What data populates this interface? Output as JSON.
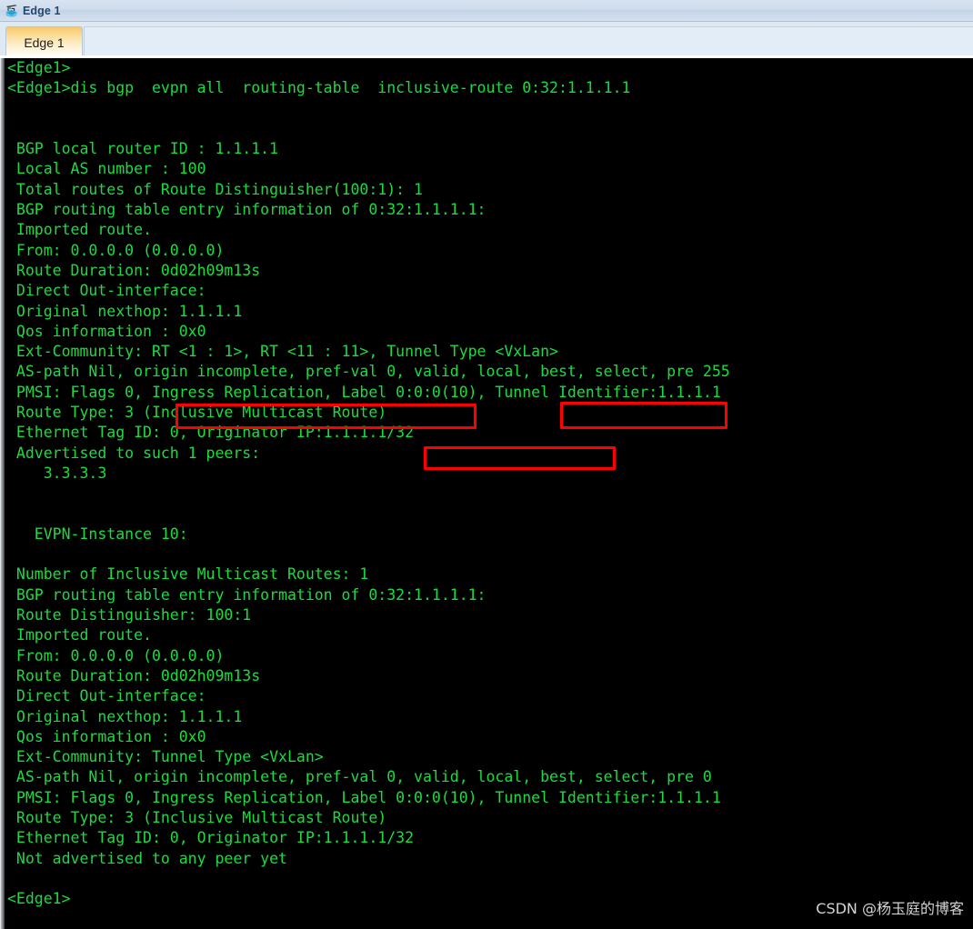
{
  "window": {
    "title": "Edge 1",
    "icon": "router-device-icon"
  },
  "tabs": [
    {
      "label": "Edge 1",
      "active": true
    }
  ],
  "watermark": "CSDN @杨玉庭的博客",
  "colors": {
    "terminal_background": "#000000",
    "terminal_text": "#19dd3e",
    "highlight_box": "#ff0000",
    "titlebar_text": "#21486e",
    "watermark_text": "#d4d4d4",
    "tab_active_gradient_top": "#f6c96a",
    "tab_active_gradient_bottom": "#ffffff"
  },
  "terminal": {
    "prompt": "<Edge1>",
    "command": "dis bgp  evpn all  routing-table  inclusive-route 0:32:1.1.1.1",
    "lines": [
      "<Edge1>",
      "<Edge1>dis bgp  evpn all  routing-table  inclusive-route 0:32:1.1.1.1",
      "",
      "",
      " BGP local router ID : 1.1.1.1",
      " Local AS number : 100",
      " Total routes of Route Distinguisher(100:1): 1",
      " BGP routing table entry information of 0:32:1.1.1.1:",
      " Imported route.",
      " From: 0.0.0.0 (0.0.0.0)",
      " Route Duration: 0d02h09m13s",
      " Direct Out-interface:",
      " Original nexthop: 1.1.1.1",
      " Qos information : 0x0",
      " Ext-Community: RT <1 : 1>, RT <11 : 11>, Tunnel Type <VxLan>",
      " AS-path Nil, origin incomplete, pref-val 0, valid, local, best, select, pre 255",
      " PMSI: Flags 0, Ingress Replication, Label 0:0:0(10), Tunnel Identifier:1.1.1.1",
      " Route Type: 3 (Inclusive Multicast Route)",
      " Ethernet Tag ID: 0, Originator IP:1.1.1.1/32",
      " Advertised to such 1 peers:",
      "    3.3.3.3",
      "",
      "",
      "   EVPN-Instance 10:",
      "",
      " Number of Inclusive Multicast Routes: 1",
      " BGP routing table entry information of 0:32:1.1.1.1:",
      " Route Distinguisher: 100:1",
      " Imported route.",
      " From: 0.0.0.0 (0.0.0.0)",
      " Route Duration: 0d02h09m13s",
      " Direct Out-interface:",
      " Original nexthop: 1.1.1.1",
      " Qos information : 0x0",
      " Ext-Community: Tunnel Type <VxLan>",
      " AS-path Nil, origin incomplete, pref-val 0, valid, local, best, select, pre 0",
      " PMSI: Flags 0, Ingress Replication, Label 0:0:0(10), Tunnel Identifier:1.1.1.1",
      " Route Type: 3 (Inclusive Multicast Route)",
      " Ethernet Tag ID: 0, Originator IP:1.1.1.1/32",
      " Not advertised to any peer yet",
      "",
      "<Edge1>"
    ]
  },
  "highlights": [
    {
      "id": "hl-rt",
      "text": "RT <1 : 1>, RT <11 : 11>,"
    },
    {
      "id": "hl-tuntype",
      "text": "Type <VxLan>"
    },
    {
      "id": "hl-label",
      "text": "Label 0:0:0(10),"
    }
  ]
}
